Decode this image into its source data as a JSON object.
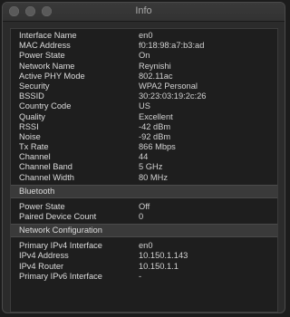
{
  "window": {
    "title": "Info"
  },
  "wifi": [
    {
      "label": "Interface Name",
      "value": "en0"
    },
    {
      "label": "MAC Address",
      "value": "f0:18:98:a7:b3:ad"
    },
    {
      "label": "Power State",
      "value": "On"
    },
    {
      "label": "Network Name",
      "value": "Reynishi"
    },
    {
      "label": "Active PHY Mode",
      "value": "802.11ac"
    },
    {
      "label": "Security",
      "value": "WPA2 Personal"
    },
    {
      "label": "BSSID",
      "value": "30:23:03:19:2c:26"
    },
    {
      "label": "Country Code",
      "value": "US"
    },
    {
      "label": "Quality",
      "value": "Excellent"
    },
    {
      "label": "RSSI",
      "value": "-42 dBm"
    },
    {
      "label": "Noise",
      "value": "-92 dBm"
    },
    {
      "label": "Tx Rate",
      "value": "866 Mbps"
    },
    {
      "label": "Channel",
      "value": "44"
    },
    {
      "label": "Channel Band",
      "value": "5 GHz"
    },
    {
      "label": "Channel Width",
      "value": "80 MHz"
    }
  ],
  "bluetooth": {
    "header": "Bluetooth",
    "rows": [
      {
        "label": "Power State",
        "value": "Off"
      },
      {
        "label": "Paired Device Count",
        "value": "0"
      }
    ]
  },
  "network": {
    "header": "Network Configuration",
    "rows": [
      {
        "label": "Primary IPv4 Interface",
        "value": "en0"
      },
      {
        "label": "IPv4 Address",
        "value": "10.150.1.143"
      },
      {
        "label": "IPv4 Router",
        "value": "10.150.1.1"
      },
      {
        "label": "Primary IPv6 Interface",
        "value": "-"
      }
    ]
  }
}
